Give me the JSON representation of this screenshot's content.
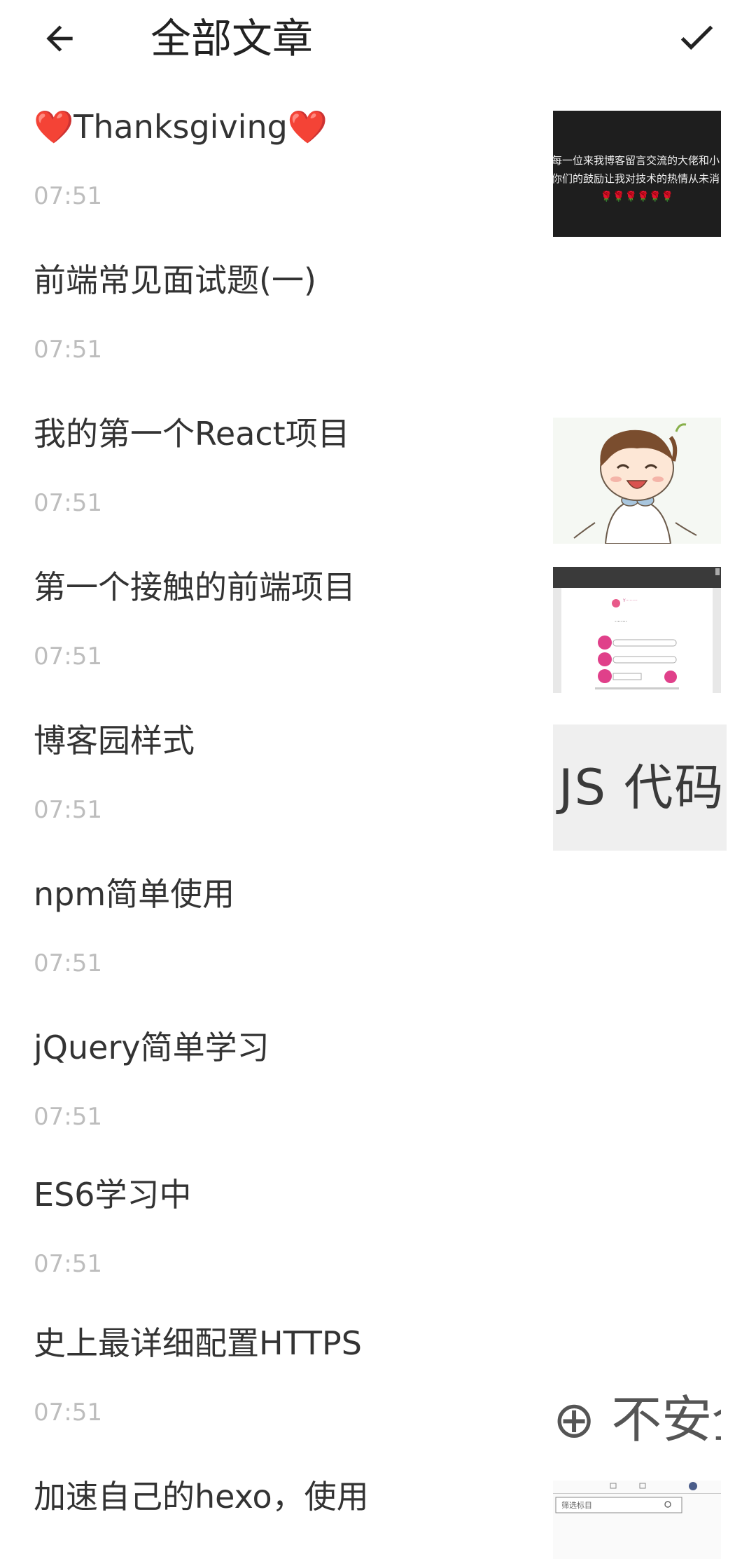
{
  "header": {
    "title": "全部文章",
    "back_icon": "arrow-left-icon",
    "confirm_icon": "check-icon"
  },
  "articles": [
    {
      "title": "❤️Thanksgiving❤️",
      "time": "07:51",
      "thumbnail": "dark-banner"
    },
    {
      "title": "前端常见面试题(一)",
      "time": "07:51",
      "thumbnail": null
    },
    {
      "title": "我的第一个React项目",
      "time": "07:51",
      "thumbnail": "cartoon-boy"
    },
    {
      "title": "第一个接触的前端项目",
      "time": "07:51",
      "thumbnail": "login-screenshot"
    },
    {
      "title": "博客园样式",
      "time": "07:51",
      "thumbnail": "js-code-text"
    },
    {
      "title": "npm简单使用",
      "time": "07:51",
      "thumbnail": null
    },
    {
      "title": "jQuery简单学习",
      "time": "07:51",
      "thumbnail": null
    },
    {
      "title": "ES6学习中",
      "time": "07:51",
      "thumbnail": null
    },
    {
      "title": "史上最详细配置HTTPS",
      "time": "07:51",
      "thumbnail": "unsafe-text"
    },
    {
      "title": "加速自己的hexo，使用",
      "time": "",
      "thumbnail": "search-ui"
    }
  ],
  "thumb_texts": {
    "dark_line1": "每一位来我博客留言交流的大佬和小",
    "dark_line2": "你们的鼓励让我对技术的热情从未消",
    "dark_flowers": "🌹🌹🌹🌹🌹🌹",
    "js_text": "JS 代码",
    "unsafe_text": "⊕ 不安全",
    "search_placeholder": "筛选标目"
  },
  "colors": {
    "title_text": "#333333",
    "time_text": "#bdbdbd",
    "background": "#ffffff"
  }
}
